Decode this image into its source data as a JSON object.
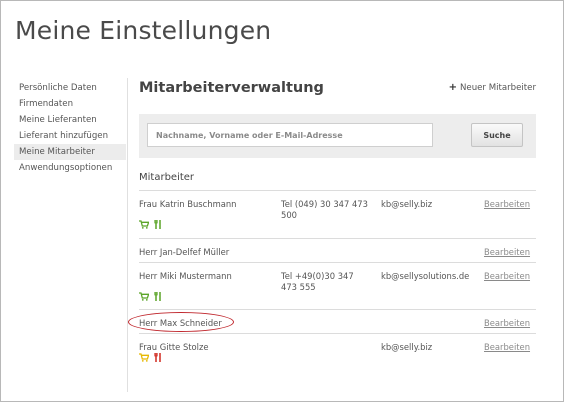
{
  "page": {
    "title": "Meine Einstellungen"
  },
  "sidebar": {
    "items": [
      {
        "label": "Persönliche Daten"
      },
      {
        "label": "Firmendaten"
      },
      {
        "label": "Meine Lieferanten"
      },
      {
        "label": "Lieferant hinzufügen"
      },
      {
        "label": "Meine Mitarbeiter",
        "active": true
      },
      {
        "label": "Anwendungsoptionen"
      }
    ]
  },
  "main": {
    "title": "Mitarbeiterverwaltung",
    "new_button_label": "Neuer Mitarbeiter",
    "search": {
      "placeholder": "Nachname, Vorname oder E-Mail-Adresse",
      "button_label": "Suche"
    },
    "list_heading": "Mitarbeiter",
    "employees": [
      {
        "name": "Frau Katrin Buschmann",
        "tel": "Tel (049) 30 347 473 500",
        "email": "kb@selly.biz",
        "edit_label": "Bearbeiten",
        "cart_icon": "cart-icon-green",
        "cutlery_icon": "cutlery-icon-green"
      },
      {
        "name": "Herr Jan-Delfef Müller",
        "tel": "",
        "email": "",
        "edit_label": "Bearbeiten"
      },
      {
        "name": "Herr Miki Mustermann",
        "tel": "Tel +49(0)30 347 473 555",
        "email": "kb@sellysolutions.de",
        "edit_label": "Bearbeiten",
        "cart_icon": "cart-icon-green",
        "cutlery_icon": "cutlery-icon-green"
      },
      {
        "name": "Herr Max Schneider",
        "tel": "",
        "email": "",
        "edit_label": "Bearbeiten",
        "highlighted": true
      },
      {
        "name": "Frau Gitte Stolze",
        "tel": "",
        "email": "kb@selly.biz",
        "edit_label": "Bearbeiten",
        "cart_icon": "cart-icon-yellow",
        "cutlery_icon": "cutlery-icon-red"
      }
    ]
  },
  "colors": {
    "green": "#5aa427",
    "yellow": "#e6b800",
    "red": "#d0281e",
    "highlight": "#c0282e"
  }
}
